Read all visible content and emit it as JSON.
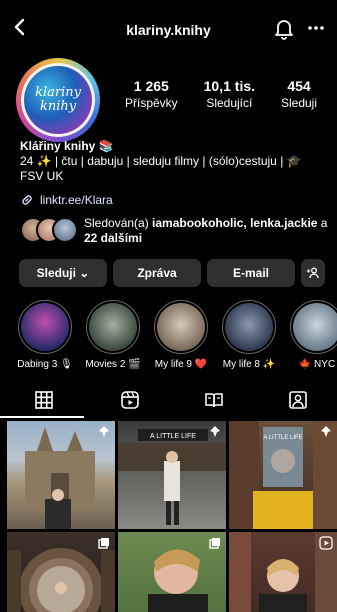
{
  "header": {
    "username": "klariny.knihy",
    "icons": [
      "back-icon",
      "bell-icon",
      "more-icon"
    ]
  },
  "profile": {
    "avatar_text": [
      "klariny",
      "knihy"
    ],
    "stats": [
      {
        "num": "1 265",
        "label": "Příspěvky"
      },
      {
        "num": "10,1 tis.",
        "label": "Sledující"
      },
      {
        "num": "454",
        "label": "Sleduji"
      }
    ],
    "name": "Klářiny knihy 📚",
    "bio": "24 ✨ | čtu | dabuju | sleduju filmy | (sólo)cestuju | 🎓 FSV UK",
    "link": "linktr.ee/Klara",
    "followed_by": {
      "prefix": "Sledován(a) ",
      "names": "iamabookoholic, lenka.jackie",
      "middle": " a ",
      "others": "22 dalšími"
    }
  },
  "buttons": {
    "follow": "Sleduji ⌄",
    "message": "Zpráva",
    "email": "E-mail",
    "add_person": "+👤"
  },
  "highlights": [
    {
      "label": "Dabing 3 🎙"
    },
    {
      "label": "Movies 2 🎬"
    },
    {
      "label": "My life 9 ❤️"
    },
    {
      "label": "My life 8 ✨"
    },
    {
      "label": "🍁 NYC"
    }
  ],
  "tabs": [
    "grid-icon",
    "reels-icon",
    "guides-icon",
    "tagged-icon"
  ],
  "grid": {
    "cells": [
      {
        "name": "post-cathedral",
        "badge": "pin-icon"
      },
      {
        "name": "post-a-little-life",
        "badge": "pin-icon"
      },
      {
        "name": "post-book-held",
        "badge": "pin-icon"
      },
      {
        "name": "post-library-window",
        "badge": "carousel-icon"
      },
      {
        "name": "post-portrait-glasses",
        "badge": "carousel-icon"
      },
      {
        "name": "post-bookstore",
        "badge": "reel-icon"
      }
    ],
    "cover_text": [
      "A LITTLE LIFE",
      "A LITTLE LIFE"
    ]
  }
}
